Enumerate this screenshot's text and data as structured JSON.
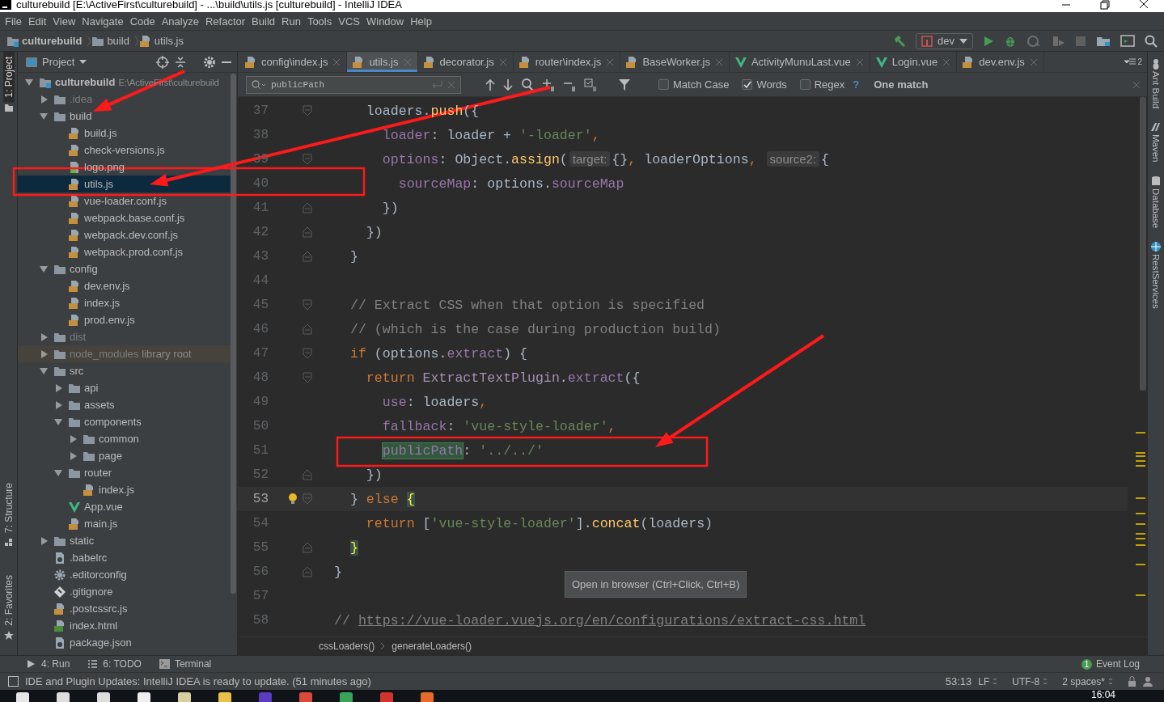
{
  "window": {
    "title": "culturebuild [E:\\ActiveFirst\\culturebuild] - ...\\build\\utils.js [culturebuild] - IntelliJ IDEA"
  },
  "menu": [
    "File",
    "Edit",
    "View",
    "Navigate",
    "Code",
    "Analyze",
    "Refactor",
    "Build",
    "Run",
    "Tools",
    "VCS",
    "Window",
    "Help"
  ],
  "navigation": {
    "breadcrumbs": [
      {
        "label": "culturebuild",
        "kind": "module"
      },
      {
        "label": "build",
        "kind": "folder"
      },
      {
        "label": "utils.js",
        "kind": "js"
      }
    ],
    "run_config": "dev"
  },
  "left_tool_windows": [
    {
      "label": "1: Project",
      "selected": true
    },
    {
      "label": "7: Structure",
      "selected": false
    },
    {
      "label": "2: Favorites",
      "selected": false
    }
  ],
  "right_tool_windows": [
    "Ant Build",
    "Maven",
    "Database",
    "RestServices"
  ],
  "project": {
    "title": "Project",
    "tree": [
      {
        "name": "culturebuild",
        "kind": "module",
        "note": "E:\\ActiveFirst\\culturebuild",
        "selected": false,
        "dimmed": false,
        "expanded": true,
        "children": [
          {
            "name": ".idea",
            "kind": "folder",
            "selected": false,
            "dimmed": true,
            "expanded": false
          },
          {
            "name": "build",
            "kind": "folder",
            "selected": false,
            "dimmed": false,
            "expanded": true,
            "children": [
              {
                "name": "build.js",
                "kind": "js",
                "selected": false,
                "dimmed": false
              },
              {
                "name": "check-versions.js",
                "kind": "js",
                "selected": false,
                "dimmed": false
              },
              {
                "name": "logo.png",
                "kind": "image",
                "selected": false,
                "dimmed": false
              },
              {
                "name": "utils.js",
                "kind": "js",
                "selected": true,
                "dimmed": false
              },
              {
                "name": "vue-loader.conf.js",
                "kind": "js",
                "selected": false,
                "dimmed": false
              },
              {
                "name": "webpack.base.conf.js",
                "kind": "js",
                "selected": false,
                "dimmed": false
              },
              {
                "name": "webpack.dev.conf.js",
                "kind": "js",
                "selected": false,
                "dimmed": false
              },
              {
                "name": "webpack.prod.conf.js",
                "kind": "js",
                "selected": false,
                "dimmed": false
              }
            ]
          },
          {
            "name": "config",
            "kind": "folder",
            "selected": false,
            "dimmed": false,
            "expanded": true,
            "children": [
              {
                "name": "dev.env.js",
                "kind": "js",
                "selected": false,
                "dimmed": false
              },
              {
                "name": "index.js",
                "kind": "js",
                "selected": false,
                "dimmed": false
              },
              {
                "name": "prod.env.js",
                "kind": "js",
                "selected": false,
                "dimmed": false
              }
            ]
          },
          {
            "name": "dist",
            "kind": "folder",
            "selected": false,
            "dimmed": true,
            "expanded": false
          },
          {
            "name": "node_modules",
            "kind": "folder",
            "note": "library root",
            "selected": false,
            "dimmed": true,
            "expanded": false
          },
          {
            "name": "src",
            "kind": "folder",
            "selected": false,
            "dimmed": false,
            "expanded": true,
            "children": [
              {
                "name": "api",
                "kind": "folder",
                "selected": false,
                "dimmed": false,
                "expanded": false
              },
              {
                "name": "assets",
                "kind": "folder",
                "selected": false,
                "dimmed": false,
                "expanded": false
              },
              {
                "name": "components",
                "kind": "folder",
                "selected": false,
                "dimmed": false,
                "expanded": true,
                "children": [
                  {
                    "name": "common",
                    "kind": "folder",
                    "selected": false,
                    "dimmed": false,
                    "expanded": false
                  },
                  {
                    "name": "page",
                    "kind": "folder",
                    "selected": false,
                    "dimmed": false,
                    "expanded": false
                  }
                ]
              },
              {
                "name": "router",
                "kind": "folder",
                "selected": false,
                "dimmed": false,
                "expanded": true,
                "children": [
                  {
                    "name": "index.js",
                    "kind": "js",
                    "selected": false,
                    "dimmed": false
                  }
                ]
              },
              {
                "name": "App.vue",
                "kind": "vue",
                "selected": false,
                "dimmed": false
              },
              {
                "name": "main.js",
                "kind": "js",
                "selected": false,
                "dimmed": false
              }
            ]
          },
          {
            "name": "static",
            "kind": "folder",
            "selected": false,
            "dimmed": false,
            "expanded": false
          },
          {
            "name": ".babelrc",
            "kind": "config",
            "selected": false,
            "dimmed": false
          },
          {
            "name": ".editorconfig",
            "kind": "gear",
            "selected": false,
            "dimmed": false
          },
          {
            "name": ".gitignore",
            "kind": "git",
            "selected": false,
            "dimmed": false
          },
          {
            "name": ".postcssrc.js",
            "kind": "js",
            "selected": false,
            "dimmed": false
          },
          {
            "name": "index.html",
            "kind": "html",
            "selected": false,
            "dimmed": false
          },
          {
            "name": "package.json",
            "kind": "config",
            "selected": false,
            "dimmed": false
          }
        ]
      }
    ]
  },
  "editor": {
    "tabs": [
      {
        "label": "config\\index.js",
        "kind": "js",
        "selected": false
      },
      {
        "label": "utils.js",
        "kind": "js",
        "selected": true
      },
      {
        "label": "decorator.js",
        "kind": "js",
        "selected": false
      },
      {
        "label": "router\\index.js",
        "kind": "js",
        "selected": false
      },
      {
        "label": "BaseWorker.js",
        "kind": "js",
        "selected": false
      },
      {
        "label": "ActivityMunuLast.vue",
        "kind": "vue",
        "selected": false
      },
      {
        "label": "Login.vue",
        "kind": "vue",
        "selected": false
      },
      {
        "label": "dev.env.js",
        "kind": "js",
        "selected": false
      }
    ],
    "hidden_tabs": "2",
    "find": {
      "value": "publicPath",
      "options": [
        {
          "label": "Match Case",
          "checked": false
        },
        {
          "label": "Words",
          "checked": true
        },
        {
          "label": "Regex",
          "checked": false
        }
      ],
      "help": "?",
      "result": "One match"
    },
    "lines": [
      {
        "number": "37",
        "current": false,
        "kind": "fold-start",
        "tokens": [
          {
            "kind": "plain",
            "text": "    loaders."
          },
          {
            "kind": "fn",
            "text": "push"
          },
          {
            "kind": "plain",
            "text": "({"
          }
        ]
      },
      {
        "number": "38",
        "current": false,
        "kind": "plain",
        "tokens": [
          {
            "kind": "prop",
            "text": "      loader"
          },
          {
            "kind": "plain",
            "text": ": loader + "
          },
          {
            "kind": "str",
            "text": "'-loader'"
          },
          {
            "kind": "kw",
            "text": ","
          }
        ]
      },
      {
        "number": "39",
        "current": false,
        "kind": "fold-start",
        "tokens": [
          {
            "kind": "prop",
            "text": "      options"
          },
          {
            "kind": "plain",
            "text": ": Object."
          },
          {
            "kind": "fn",
            "text": "assign"
          },
          {
            "kind": "plain",
            "text": "("
          },
          {
            "kind": "hint",
            "text": "target:"
          },
          {
            "kind": "plain",
            "text": "{}"
          },
          {
            "kind": "kw",
            "text": ", "
          },
          {
            "kind": "plain",
            "text": "loaderOptions"
          },
          {
            "kind": "kw",
            "text": ", "
          },
          {
            "kind": "hint",
            "text": "source2:"
          },
          {
            "kind": "plain",
            "text": "{"
          }
        ]
      },
      {
        "number": "40",
        "current": false,
        "kind": "plain",
        "tokens": [
          {
            "kind": "prop",
            "text": "        sourceMap"
          },
          {
            "kind": "plain",
            "text": ": options."
          },
          {
            "kind": "prop",
            "text": "sourceMap"
          }
        ]
      },
      {
        "number": "41",
        "current": false,
        "kind": "fold-end",
        "tokens": [
          {
            "kind": "plain",
            "text": "      })"
          }
        ]
      },
      {
        "number": "42",
        "current": false,
        "kind": "fold-end",
        "tokens": [
          {
            "kind": "plain",
            "text": "    })"
          }
        ]
      },
      {
        "number": "43",
        "current": false,
        "kind": "fold-end",
        "tokens": [
          {
            "kind": "plain",
            "text": "  }"
          }
        ]
      },
      {
        "number": "44",
        "current": false,
        "kind": "plain"
      },
      {
        "number": "45",
        "current": false,
        "kind": "fold-start",
        "tokens": [
          {
            "kind": "comment",
            "text": "  // Extract CSS when that option is specified"
          }
        ]
      },
      {
        "number": "46",
        "current": false,
        "kind": "fold-end",
        "tokens": [
          {
            "kind": "comment",
            "text": "  // (which is the case during production build)"
          }
        ]
      },
      {
        "number": "47",
        "current": false,
        "kind": "fold-start",
        "tokens": [
          {
            "kind": "kw",
            "text": "  if"
          },
          {
            "kind": "plain",
            "text": " (options."
          },
          {
            "kind": "prop",
            "text": "extract"
          },
          {
            "kind": "plain",
            "text": ") {"
          }
        ]
      },
      {
        "number": "48",
        "current": false,
        "kind": "fold-start",
        "tokens": [
          {
            "kind": "kw",
            "text": "    return "
          },
          {
            "kind": "cls",
            "text": "ExtractTextPlugin"
          },
          {
            "kind": "plain",
            "text": "."
          },
          {
            "kind": "prop",
            "text": "extract"
          },
          {
            "kind": "plain",
            "text": "({"
          }
        ]
      },
      {
        "number": "49",
        "current": false,
        "kind": "plain",
        "tokens": [
          {
            "kind": "prop",
            "text": "      use"
          },
          {
            "kind": "plain",
            "text": ": loaders"
          },
          {
            "kind": "kw",
            "text": ","
          }
        ]
      },
      {
        "number": "50",
        "current": false,
        "kind": "plain",
        "tokens": [
          {
            "kind": "prop",
            "text": "      fallback"
          },
          {
            "kind": "plain",
            "text": ": "
          },
          {
            "kind": "str",
            "text": "'vue-style-loader'"
          },
          {
            "kind": "kw",
            "text": ","
          }
        ]
      },
      {
        "number": "51",
        "current": false,
        "kind": "plain",
        "tokens": [
          {
            "kind": "match",
            "text": "      publicPath"
          },
          {
            "kind": "plain",
            "text": ": "
          },
          {
            "kind": "str",
            "text": "'../../'"
          }
        ]
      },
      {
        "number": "52",
        "current": false,
        "kind": "fold-end",
        "tokens": [
          {
            "kind": "plain",
            "text": "    })"
          }
        ]
      },
      {
        "number": "53",
        "current": true,
        "kind": "fold-start",
        "tokens": [
          {
            "kind": "plain",
            "text": "  } "
          },
          {
            "kind": "kw",
            "text": "else "
          },
          {
            "kind": "brace",
            "text": "{"
          }
        ]
      },
      {
        "number": "54",
        "current": false,
        "kind": "plain",
        "tokens": [
          {
            "kind": "kw",
            "text": "    return "
          },
          {
            "kind": "plain",
            "text": "["
          },
          {
            "kind": "str",
            "text": "'vue-style-loader'"
          },
          {
            "kind": "plain",
            "text": "]."
          },
          {
            "kind": "fn",
            "text": "concat"
          },
          {
            "kind": "plain",
            "text": "(loaders)"
          }
        ]
      },
      {
        "number": "55",
        "current": false,
        "kind": "fold-end",
        "tokens": [
          {
            "kind": "brace",
            "text": "  }"
          }
        ]
      },
      {
        "number": "56",
        "current": false,
        "kind": "fold-end",
        "tokens": [
          {
            "kind": "plain",
            "text": "}"
          }
        ]
      },
      {
        "number": "57",
        "current": false,
        "kind": "plain"
      },
      {
        "number": "58",
        "current": false,
        "kind": "plain",
        "tokens": [
          {
            "kind": "comment",
            "text": "// "
          },
          {
            "kind": "link",
            "text": "https://vue-loader.vuejs.org/en/configurations/extract-css.html"
          }
        ]
      }
    ],
    "tooltip": "Open in browser (Ctrl+Click, Ctrl+B)",
    "breadcrumbs": [
      "cssLoaders()",
      "generateLoaders()"
    ]
  },
  "bottom_tools": [
    {
      "label": "4: Run",
      "kind": "run"
    },
    {
      "label": "6: TODO",
      "kind": "todo"
    },
    {
      "label": "Terminal",
      "kind": "terminal"
    }
  ],
  "event_log": {
    "label": "Event Log",
    "count": "1"
  },
  "status_bar": {
    "message": "IDE and Plugin Updates: IntelliJ IDEA is ready to update. (51 minutes ago)",
    "position": "53:13",
    "line_separator": "LF",
    "encoding": "UTF-8",
    "indent": "2 spaces*"
  },
  "taskbar": {
    "time": "16:04"
  }
}
